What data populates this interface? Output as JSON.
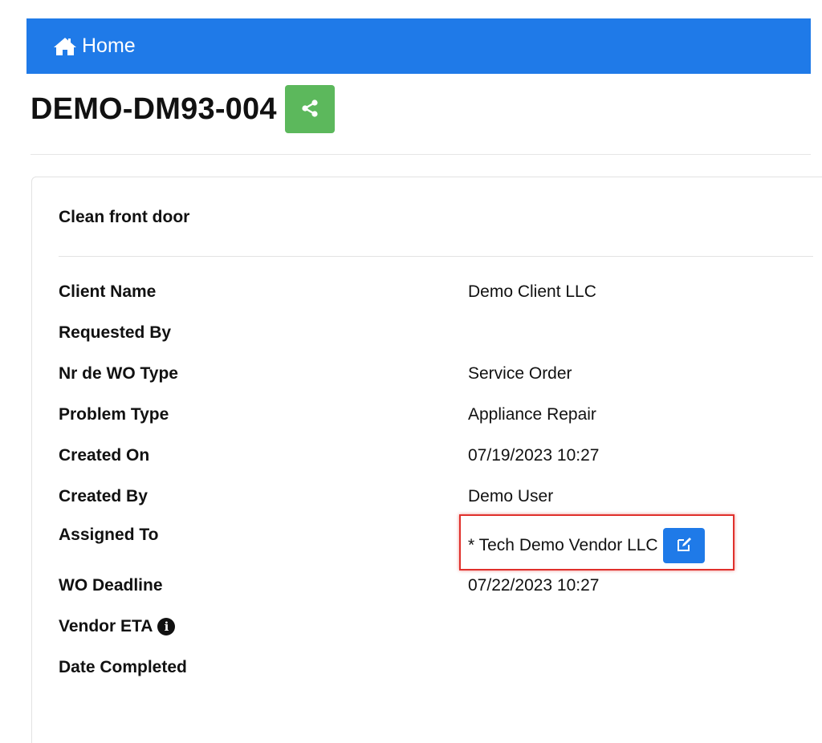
{
  "nav": {
    "home_label": "Home",
    "bar_color": "#1f7ae8"
  },
  "header": {
    "title": "DEMO-DM93-004",
    "share_icon": "share-icon",
    "share_color": "#5cb85c"
  },
  "card": {
    "heading": "Clean front door",
    "fields": [
      {
        "label": "Client Name",
        "value": "Demo Client LLC"
      },
      {
        "label": "Requested By",
        "value": ""
      },
      {
        "label": "Nr de WO Type",
        "value": "Service Order"
      },
      {
        "label": "Problem Type",
        "value": "Appliance Repair"
      },
      {
        "label": "Created On",
        "value": "07/19/2023 10:27"
      },
      {
        "label": "Created By",
        "value": "Demo User"
      },
      {
        "label": "Assigned To",
        "value": "* Tech Demo Vendor LLC",
        "edit_icon": "edit-icon"
      },
      {
        "label": "WO Deadline",
        "value": "07/22/2023 10:27"
      },
      {
        "label": "Vendor ETA",
        "value": "",
        "info_icon": "info-icon"
      },
      {
        "label": "Date Completed",
        "value": ""
      }
    ]
  },
  "highlight_color": "#e0302c"
}
